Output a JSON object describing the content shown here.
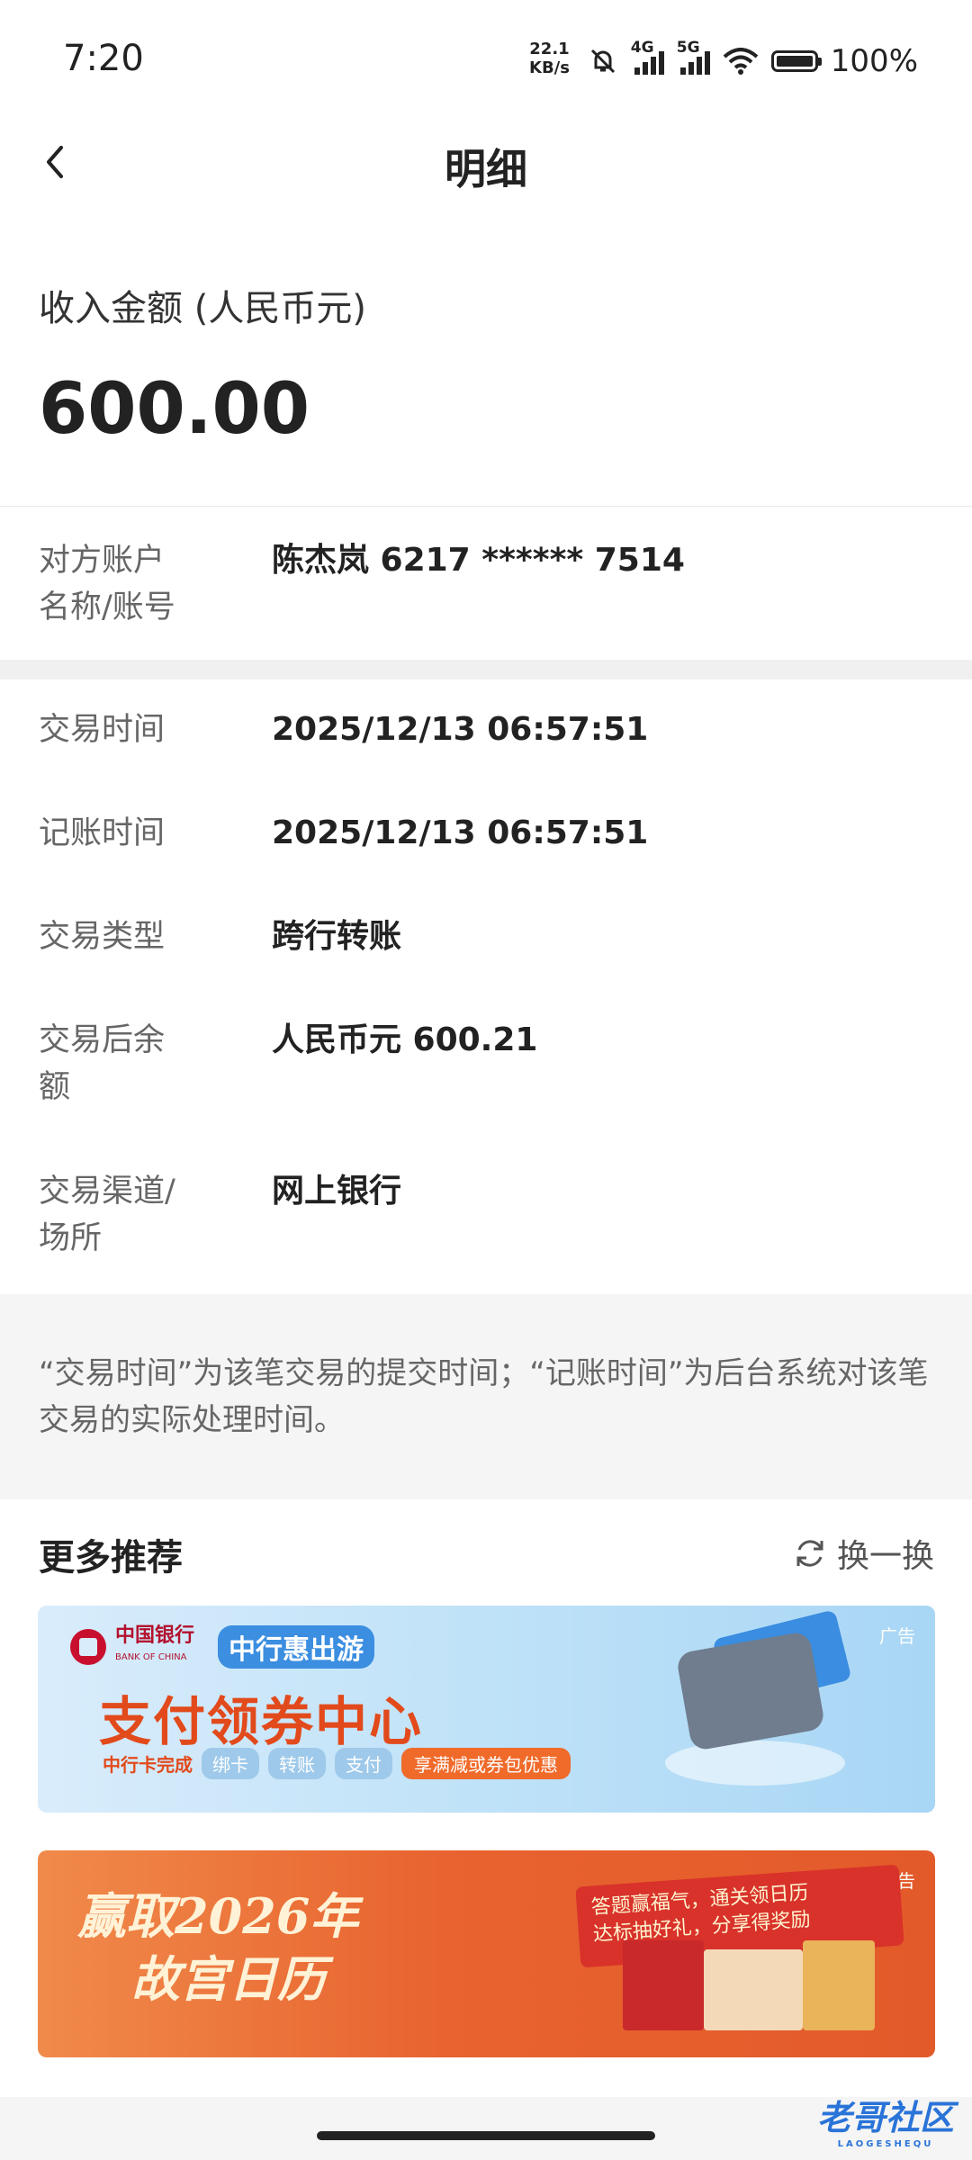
{
  "status_bar": {
    "time": "7:20",
    "net_speed_value": "22.1",
    "net_speed_unit": "KB/s",
    "signal_1": "4G",
    "signal_2": "5G",
    "battery": "100%"
  },
  "header": {
    "title": "明细"
  },
  "amount": {
    "label": "收入金额 (人民币元)",
    "value": "600.00"
  },
  "counterparty": {
    "label_line1": "对方账户",
    "label_line2": "名称/账号",
    "value": "陈杰岚 6217 ****** 7514"
  },
  "details": [
    {
      "label": "交易时间",
      "value": "2025/12/13 06:57:51"
    },
    {
      "label": "记账时间",
      "value": "2025/12/13 06:57:51"
    },
    {
      "label": "交易类型",
      "value": "跨行转账"
    },
    {
      "label_line1": "交易后余",
      "label_line2": "额",
      "value": "人民币元 600.21"
    },
    {
      "label_line1": "交易渠道/",
      "label_line2": "场所",
      "value": "网上银行"
    }
  ],
  "note": {
    "text": "“交易时间”为该笔交易的提交时间；“记账时间”为后台系统对该笔交易的实际处理时间。"
  },
  "more": {
    "title": "更多推荐",
    "refresh_label": "换一换",
    "banner1": {
      "ad_tag": "广告",
      "bank_name": "中国银行",
      "bank_name_en": "BANK OF CHINA",
      "sub_brand": "中行惠出游",
      "title": "支付领券中心",
      "lead": "中行卡完成",
      "chips": [
        "绑卡",
        "转账",
        "支付"
      ],
      "highlight": "享满减或券包优惠"
    },
    "banner2": {
      "ad_tag": "广告",
      "title_line1": "赢取2026年",
      "title_line2": "故宫日历",
      "ribbon_line1": "答题赢福气，通关领日历",
      "ribbon_line2": "达标抽好礼，分享得奖励"
    }
  },
  "watermark": {
    "text": "老哥社区",
    "sub": "LAOGESHEQU"
  }
}
